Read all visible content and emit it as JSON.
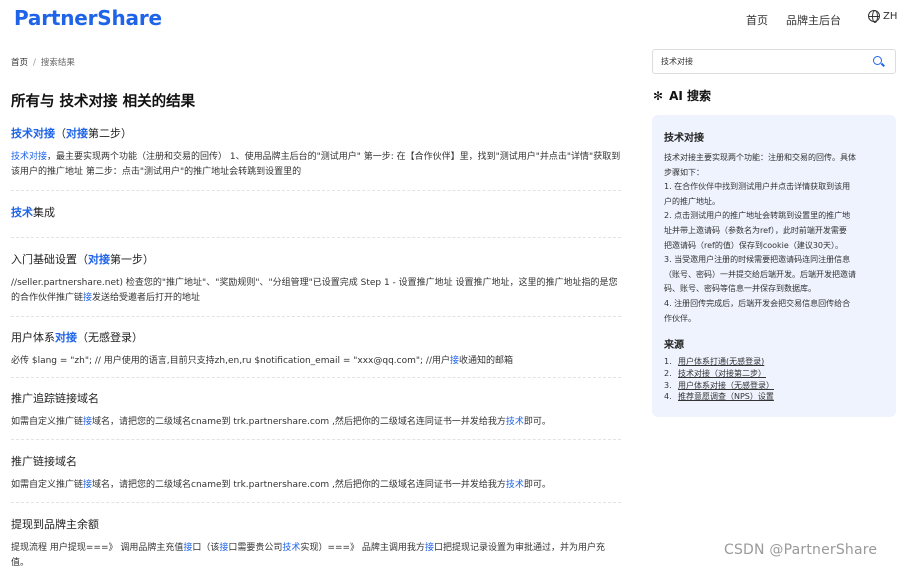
{
  "brand": {
    "logo_text": "PartnerShare"
  },
  "nav": {
    "home": "首页",
    "brand_admin": "品牌主后台",
    "lang": "ZH"
  },
  "breadcrumb": {
    "home": "首页",
    "sep": "/",
    "current": "搜索结果"
  },
  "page_title": {
    "prefix": "所有与",
    "query": " 技术对接 ",
    "suffix": "相关的结果"
  },
  "results": [
    {
      "title": [
        {
          "t": "技术对接",
          "h": true
        },
        {
          "t": "（",
          "h": false
        },
        {
          "t": "对接",
          "h": true
        },
        {
          "t": "第二步）",
          "h": false
        }
      ],
      "desc": [
        {
          "t": "技术对接",
          "h": true
        },
        {
          "t": "，最主要实现两个功能（注册和交易的回传） 1、使用品牌主后台的\"测试用户\" 第一步: 在【合作伙伴】里，找到\"测试用户\"并点击\"详情\"获取到该用户的推广地址 第二步：点击\"测试用户\"的推广地址会转跳到设置里的",
          "h": false
        }
      ]
    },
    {
      "title": [
        {
          "t": "技术",
          "h": true
        },
        {
          "t": "集成",
          "h": false
        }
      ],
      "desc": []
    },
    {
      "title": [
        {
          "t": "入门基础设置（",
          "h": false
        },
        {
          "t": "对接",
          "h": true
        },
        {
          "t": "第一步）",
          "h": false
        }
      ],
      "desc": [
        {
          "t": "//seller.partnershare.net) 检查您的\"推广地址\"、\"奖励规则\"、\"分组管理\"已设置完成 Step 1 - 设置推广地址 设置推广地址，这里的推广地址指的是您的合作伙伴推广链",
          "h": false
        },
        {
          "t": "接",
          "h": true
        },
        {
          "t": "发送给受邀者后打开的地址",
          "h": false
        }
      ]
    },
    {
      "title": [
        {
          "t": "用户体系",
          "h": false
        },
        {
          "t": "对接",
          "h": true
        },
        {
          "t": "（无感登录）",
          "h": false
        }
      ],
      "desc": [
        {
          "t": "必传 $lang = \"zh\"; // 用户使用的语言,目前只支持zh,en,ru $notification_email = \"xxx@qq.com\"; //用户",
          "h": false
        },
        {
          "t": "接",
          "h": true
        },
        {
          "t": "收通知的邮箱",
          "h": false
        }
      ]
    },
    {
      "title": [
        {
          "t": "推广追踪链接域名",
          "h": false
        }
      ],
      "desc": [
        {
          "t": "如需自定义推广链",
          "h": false
        },
        {
          "t": "接",
          "h": true
        },
        {
          "t": "域名，请把您的二级域名cname到 trk.partnershare.com ,然后把你的二级域名连同证书一并发给我方",
          "h": false
        },
        {
          "t": "技术",
          "h": true
        },
        {
          "t": "即可。",
          "h": false
        }
      ]
    },
    {
      "title": [
        {
          "t": "推广链接域名",
          "h": false
        }
      ],
      "desc": [
        {
          "t": "如需自定义推广链",
          "h": false
        },
        {
          "t": "接",
          "h": true
        },
        {
          "t": "域名，请把您的二级域名cname到 trk.partnershare.com ,然后把你的二级域名连同证书一并发给我方",
          "h": false
        },
        {
          "t": "技术",
          "h": true
        },
        {
          "t": "即可。",
          "h": false
        }
      ]
    },
    {
      "title": [
        {
          "t": "提现到品牌主余额",
          "h": false
        }
      ],
      "desc": [
        {
          "t": "提现流程 用户提现===》 调用品牌主充值",
          "h": false
        },
        {
          "t": "接",
          "h": true
        },
        {
          "t": "口（该",
          "h": false
        },
        {
          "t": "接",
          "h": true
        },
        {
          "t": "口需要贵公司",
          "h": false
        },
        {
          "t": "技术",
          "h": true
        },
        {
          "t": "实现）===》 品牌主调用我方",
          "h": false
        },
        {
          "t": "接",
          "h": true
        },
        {
          "t": "口把提现记录设置为审批通过，并为用户充值。",
          "h": false
        }
      ]
    }
  ],
  "search": {
    "value": "技术对接",
    "placeholder": ""
  },
  "ai": {
    "icon": "ai-sparkle-icon",
    "title": "AI 搜索",
    "topic": "技术对接",
    "body_lines": [
      "技术对接主要实现两个功能：注册和交易的回传。具体",
      "步骤如下：",
      "1. 在合作伙伴中找到测试用户并点击详情获取到该用",
      "户的推广地址。",
      "2. 点击测试用户的推广地址会转跳到设置里的推广地",
      "址并带上邀请码（参数名为ref），此时前端开发需要",
      "把邀请码（ref的值）保存到cookie（建议30天）。",
      "3. 当受邀用户注册的时候需要把邀请码连同注册信息",
      "（账号、密码）一并提交给后端开发。后端开发把邀请",
      "码、账号、密码等信息一并保存到数据库。",
      "4. 注册回传完成后，后端开发会把交易信息回传给合",
      "作伙伴。"
    ],
    "sources_title": "来源",
    "sources": [
      {
        "num": "1.",
        "label": "用户体系打通(无感登录)"
      },
      {
        "num": "2.",
        "label": "技术对接（对接第二步）"
      },
      {
        "num": "3.",
        "label": "用户体系对接（无感登录）"
      },
      {
        "num": "4.",
        "label": "推荐意愿调查（NPS）设置"
      }
    ]
  },
  "watermark": "CSDN @PartnerShare",
  "colors": {
    "accent": "#1f64e8",
    "panel_bg": "#eef3fe"
  }
}
